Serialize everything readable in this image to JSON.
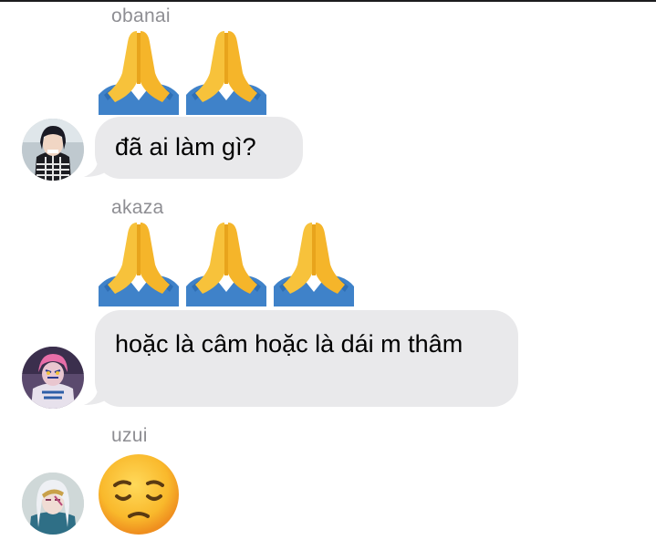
{
  "messages": [
    {
      "sender": "obanai",
      "reaction_emoji": "folded-hands",
      "reaction_count": 2,
      "text": "đã ai làm gì?"
    },
    {
      "sender": "akaza",
      "reaction_emoji": "folded-hands",
      "reaction_count": 3,
      "text": "hoặc là câm hoặc là dái m thâm"
    },
    {
      "sender": "uzui",
      "reaction_emoji": "pensive-face",
      "reaction_count": 1,
      "text": ""
    }
  ],
  "colors": {
    "bubble_bg": "#e9e9eb",
    "sender_text": "#8e8e93",
    "emoji_yellow": "#f7c23b",
    "sleeve_blue": "#3f82c9"
  }
}
